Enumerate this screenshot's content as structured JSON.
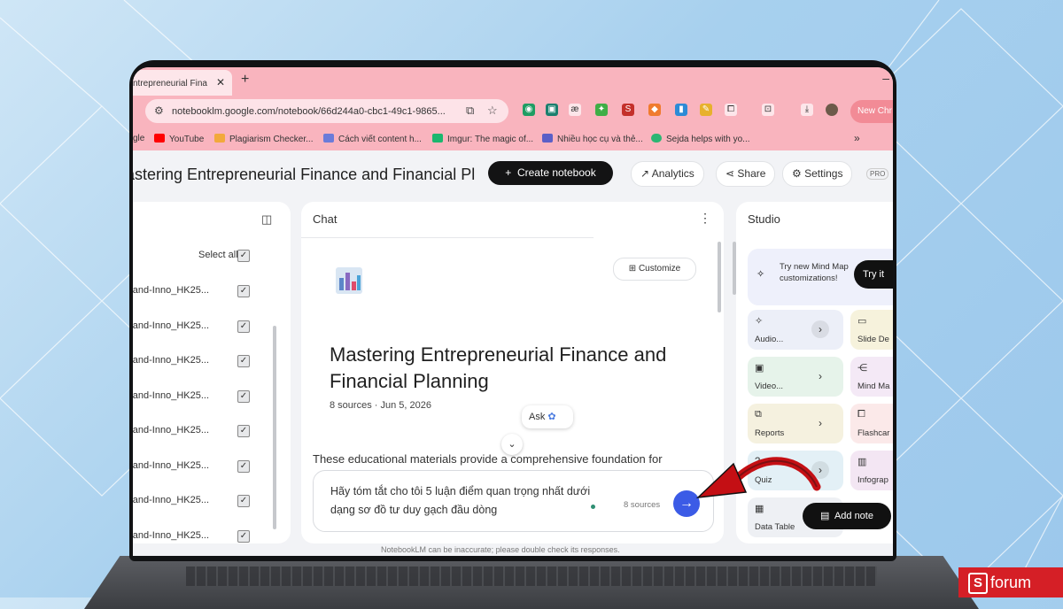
{
  "browser": {
    "tab_title": "ntrepreneurial Fina",
    "tab_close": "✕",
    "new_tab": "+",
    "url": "notebooklm.google.com/notebook/66d244a0-cbc1-49c1-9865...",
    "new_chrome_label": "New Chr",
    "bookmarks": [
      {
        "label": "gle",
        "color": "#ffffff"
      },
      {
        "label": "YouTube",
        "color": "#ff0000"
      },
      {
        "label": "Plagiarism Checker...",
        "color": "#f2a93b"
      },
      {
        "label": "Cách viết content h...",
        "color": "#6b7bd9"
      },
      {
        "label": "Imgur: The magic of...",
        "color": "#1bb76e"
      },
      {
        "label": "Nhiều học cụ và thẻ...",
        "color": "#5b5fc7"
      },
      {
        "label": "Sejda helps with yo...",
        "color": "#2bb673"
      }
    ],
    "bookmarks_more": "»"
  },
  "header": {
    "notebook_title": "astering Entrepreneurial Finance and Financial Pl",
    "create_notebook": "Create notebook",
    "analytics": "Analytics",
    "share": "Share",
    "settings": "Settings",
    "badge": "PRO"
  },
  "sources": {
    "select_all": "Select all",
    "items": [
      "e-and-Inno_HK25...",
      "e-and-Inno_HK25...",
      "e-and-Inno_HK25...",
      "e-and-Inno_HK25...",
      "e-and-Inno_HK25...",
      "e-and-Inno_HK25...",
      "e-and-Inno_HK25...",
      "e-and-Inno_HK25..."
    ],
    "checkmark": "✓"
  },
  "chat": {
    "header": "Chat",
    "customize": "Customize",
    "title": "Mastering Entrepreneurial Finance and Financial Planning",
    "meta": "8 sources · Jun 5, 2026",
    "ask": "Ask",
    "summary": "These educational materials provide a comprehensive foundation for",
    "input_text": "Hãy tóm tắt cho tôi 5 luận điểm quan trọng nhất dưới dạng sơ đồ tư duy gạch đầu dòng",
    "source_count": "8 sources",
    "disclaimer": "NotebookLM can be inaccurate; please double check its responses."
  },
  "studio": {
    "header": "Studio",
    "promo": "Try new Mind Map customizations!",
    "try_it": "Try it",
    "tiles": [
      {
        "label": "Audio...",
        "bg": "#eceff8"
      },
      {
        "label": "Slide De",
        "bg": "#f6f2dc"
      },
      {
        "label": "Video...",
        "bg": "#e6f3ea"
      },
      {
        "label": "Mind Ma",
        "bg": "#f4e9f6"
      },
      {
        "label": "Reports",
        "bg": "#f5f1df"
      },
      {
        "label": "Flashcar",
        "bg": "#fbe9e9"
      },
      {
        "label": "Quiz",
        "bg": "#e3f0f6"
      },
      {
        "label": "Infograp",
        "bg": "#f3e6f3"
      },
      {
        "label": "Data Table",
        "bg": "#eef0f4"
      }
    ],
    "add_note": "Add note"
  },
  "watermark": {
    "letter": "S",
    "text": "forum"
  }
}
